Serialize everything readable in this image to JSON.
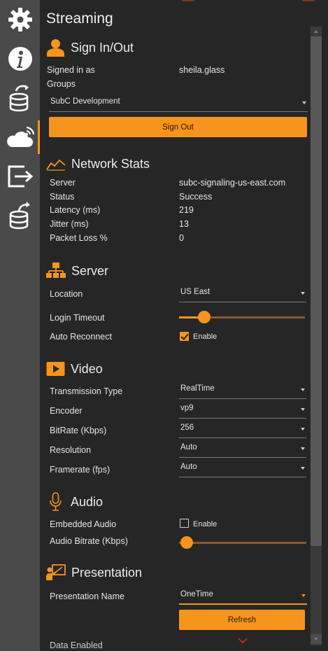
{
  "panel": {
    "title": "Streaming"
  },
  "sign_in": {
    "heading": "Sign In/Out",
    "signed_in_label": "Signed in as",
    "signed_in_value": "sheila.glass",
    "groups_label": "Groups",
    "group_selected": "SubC Development",
    "sign_out_label": "Sign Out"
  },
  "network": {
    "heading": "Network Stats",
    "rows": [
      {
        "label": "Server",
        "value": "subc-signaling-us-east.com"
      },
      {
        "label": "Status",
        "value": "Success"
      },
      {
        "label": "Latency (ms)",
        "value": "219"
      },
      {
        "label": "Jitter (ms)",
        "value": "13"
      },
      {
        "label": "Packet Loss %",
        "value": "0"
      }
    ]
  },
  "server": {
    "heading": "Server",
    "location_label": "Location",
    "location_value": "US East",
    "login_timeout_label": "Login Timeout",
    "login_timeout_level": 0.2,
    "auto_reconnect_label": "Auto Reconnect",
    "auto_reconnect_checked": true,
    "enable_label": "Enable"
  },
  "video": {
    "heading": "Video",
    "rows": [
      {
        "label": "Transmission Type",
        "value": "RealTime"
      },
      {
        "label": "Encoder",
        "value": "vp9"
      },
      {
        "label": "BitRate (Kbps)",
        "value": "256"
      },
      {
        "label": "Resolution",
        "value": "Auto"
      },
      {
        "label": "Framerate (fps)",
        "value": "Auto"
      }
    ]
  },
  "audio": {
    "heading": "Audio",
    "embedded_label": "Embedded Audio",
    "embedded_checked": false,
    "enable_label": "Enable",
    "bitrate_label": "Audio Bitrate (Kbps)",
    "bitrate_level": 0.0
  },
  "presentation": {
    "heading": "Presentation",
    "name_label": "Presentation Name",
    "name_value": "OneTime",
    "refresh_label": "Refresh",
    "next_label": "Data Enabled"
  },
  "colors": {
    "accent": "#f7941d",
    "background": "#262626",
    "sidebar": "#4a4a4a"
  },
  "sidebar_icons": [
    "gear-icon",
    "info-icon",
    "database-sync-icon",
    "cloud-broadcast-icon",
    "export-icon",
    "database-export-icon"
  ]
}
